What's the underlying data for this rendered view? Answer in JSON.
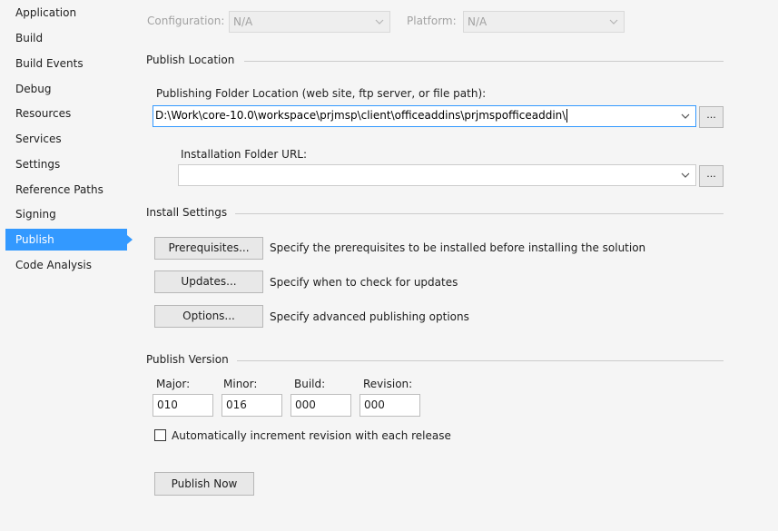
{
  "sidebar": {
    "items": [
      {
        "label": "Application"
      },
      {
        "label": "Build"
      },
      {
        "label": "Build Events"
      },
      {
        "label": "Debug"
      },
      {
        "label": "Resources"
      },
      {
        "label": "Services"
      },
      {
        "label": "Settings"
      },
      {
        "label": "Reference Paths"
      },
      {
        "label": "Signing"
      },
      {
        "label": "Publish",
        "selected": true
      },
      {
        "label": "Code Analysis"
      }
    ]
  },
  "toolbar": {
    "configuration_label": "Configuration:",
    "configuration_value": "N/A",
    "platform_label": "Platform:",
    "platform_value": "N/A"
  },
  "publish_location": {
    "section_title": "Publish Location",
    "folder_label": "Publishing Folder Location (web site, ftp server, or file path):",
    "folder_value": "D:\\Work\\core-10.0\\workspace\\prjmsp\\client\\officeaddins\\prjmspofficeaddin\\",
    "browse_label": "...",
    "install_url_label": "Installation Folder URL:",
    "install_url_value": "",
    "install_browse_label": "..."
  },
  "install_settings": {
    "section_title": "Install Settings",
    "prerequisites_button": "Prerequisites...",
    "prerequisites_desc": "Specify the prerequisites to be installed before installing the solution",
    "updates_button": "Updates...",
    "updates_desc": "Specify when to check for updates",
    "options_button": "Options...",
    "options_desc": "Specify advanced publishing options"
  },
  "publish_version": {
    "section_title": "Publish Version",
    "major_label": "Major:",
    "major_value": "010",
    "minor_label": "Minor:",
    "minor_value": "016",
    "build_label": "Build:",
    "build_value": "000",
    "revision_label": "Revision:",
    "revision_value": "000",
    "auto_increment_label": "Automatically increment revision with each release",
    "auto_increment_checked": false
  },
  "publish_now_button": "Publish Now",
  "colors": {
    "accent": "#3399ff",
    "background": "#f5f5f5"
  }
}
